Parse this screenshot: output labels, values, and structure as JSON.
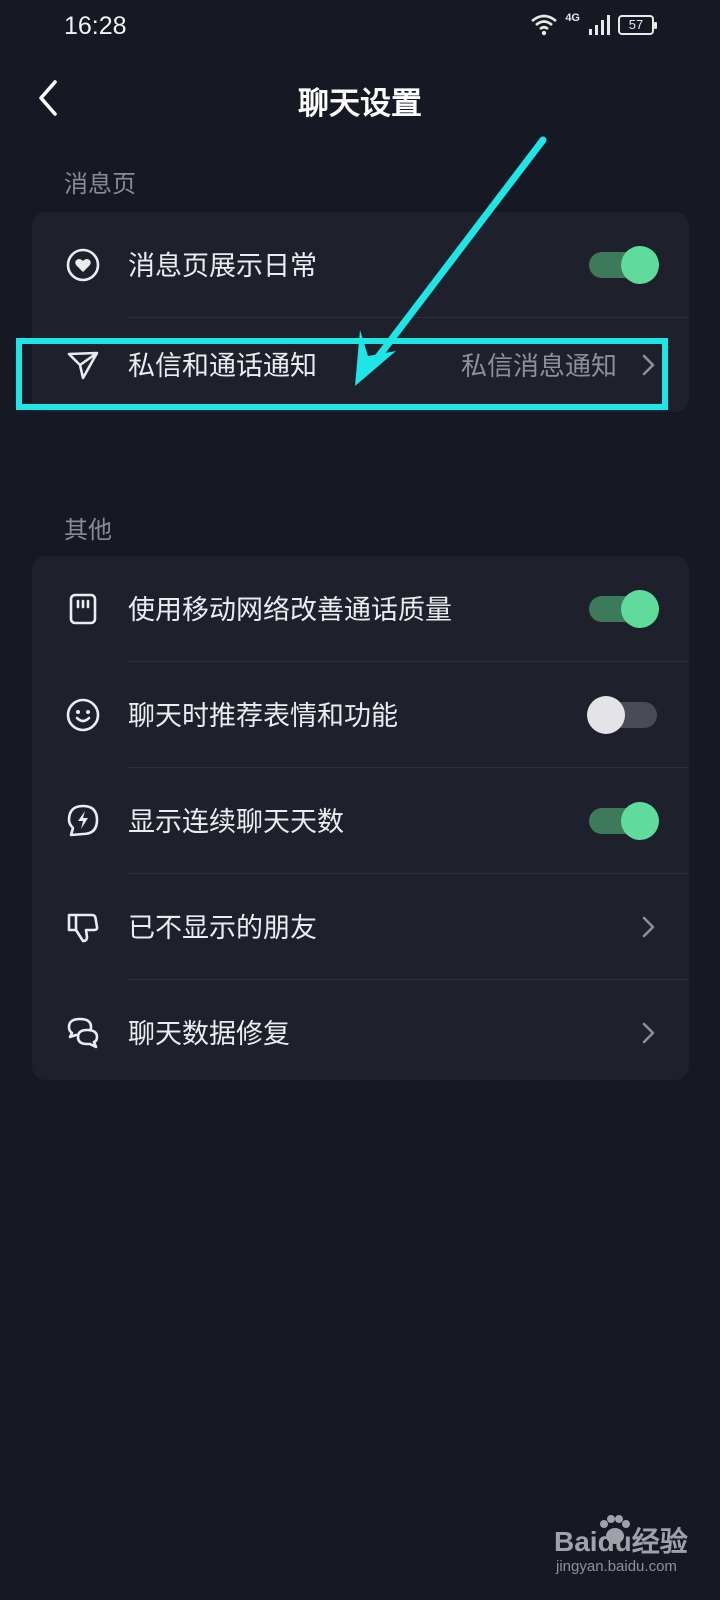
{
  "status_bar": {
    "time": "16:28",
    "network": "4G",
    "battery": "57"
  },
  "header": {
    "title": "聊天设置",
    "back_icon": "chevron-left-icon"
  },
  "sections": [
    {
      "label": "消息页",
      "items": [
        {
          "icon": "heart-circle-icon",
          "label": "消息页展示日常",
          "control": "toggle",
          "on": true
        },
        {
          "icon": "send-icon",
          "label": "私信和通话通知",
          "value": "私信消息通知",
          "control": "chevron"
        }
      ]
    },
    {
      "label": "其他",
      "items": [
        {
          "icon": "sim-card-icon",
          "label": "使用移动网络改善通话质量",
          "control": "toggle",
          "on": true
        },
        {
          "icon": "smile-icon",
          "label": "聊天时推荐表情和功能",
          "control": "toggle",
          "on": false
        },
        {
          "icon": "lightning-bubble-icon",
          "label": "显示连续聊天天数",
          "control": "toggle",
          "on": true
        },
        {
          "icon": "thumbs-down-icon",
          "label": "已不显示的朋友",
          "control": "chevron"
        },
        {
          "icon": "chat-bubbles-icon",
          "label": "聊天数据修复",
          "control": "chevron"
        }
      ]
    }
  ],
  "colors": {
    "background": "#161823",
    "card": "#1e202b",
    "toggle_on": "#5fdb9b",
    "highlight": "#1fe6e6"
  },
  "watermark": {
    "brand": "Baidu经验",
    "url": "jingyan.baidu.com"
  }
}
